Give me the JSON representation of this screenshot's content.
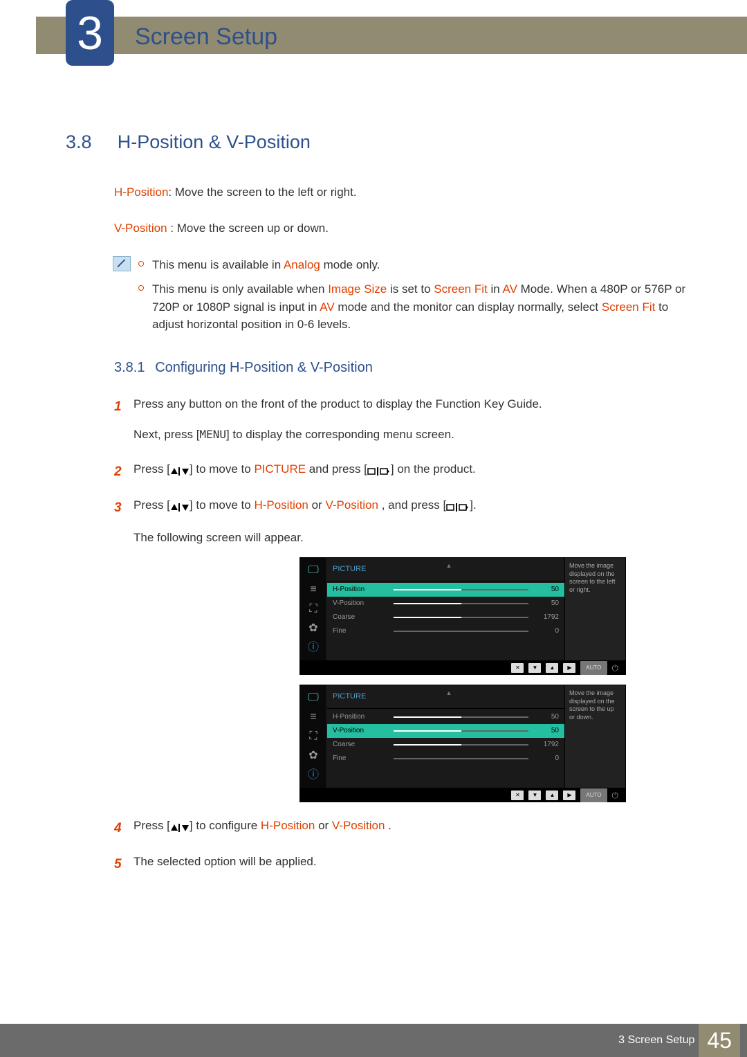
{
  "chapter": {
    "number": "3",
    "title": "Screen Setup"
  },
  "section": {
    "number": "3.8",
    "title": "H-Position & V-Position"
  },
  "intro": {
    "hpos_label": "H-Position",
    "hpos_text": ": Move the screen to the left or right.",
    "vpos_label": "V-Position",
    "vpos_text": " : Move the screen up or down."
  },
  "notes": {
    "item1_pre": "This menu is available in ",
    "item1_mode": "Analog",
    "item1_post": " mode only.",
    "item2_a": "This menu is only available when ",
    "item2_b": "Image Size",
    "item2_c": " is set to ",
    "item2_d": "Screen Fit",
    "item2_e": " in ",
    "item2_f": "AV",
    "item2_g": " Mode. When a 480P or 576P or 720P or 1080P signal is input in ",
    "item2_h": "AV",
    "item2_i": " mode and the monitor can display normally, select ",
    "item2_j": "Screen Fit",
    "item2_k": " to adjust horizontal position in 0-6 levels."
  },
  "subsection": {
    "number": "3.8.1",
    "title": "Configuring H-Position & V-Position"
  },
  "steps": {
    "n1": "1",
    "s1a": "Press any button on the front of the product to display the Function Key Guide.",
    "s1b_pre": "Next, press [",
    "s1b_menu": "MENU",
    "s1b_post": "] to display the corresponding menu screen.",
    "n2": "2",
    "s2_pre": "Press [",
    "s2_mid": "] to move to ",
    "s2_pic": "PICTURE",
    "s2_mid2": " and press [",
    "s2_post": "] on the product.",
    "n3": "3",
    "s3_pre": "Press [",
    "s3_mid": "] to move to ",
    "s3_h": "H-Position",
    "s3_or": " or ",
    "s3_v": " V-Position",
    "s3_mid2": " , and press [",
    "s3_post": "].",
    "s3_follow": "The following screen will appear.",
    "n4": "4",
    "s4_pre": "Press [",
    "s4_mid": "] to configure ",
    "s4_h": "H-Position",
    "s4_or": " or ",
    "s4_v": " V-Position",
    "s4_post": " .",
    "n5": "5",
    "s5": "The selected option will be applied."
  },
  "osd": {
    "picture_label": "PICTURE",
    "hpos": "H-Position",
    "vpos": "V-Position",
    "coarse": "Coarse",
    "fine": "Fine",
    "val_hpos": "50",
    "val_vpos": "50",
    "val_coarse": "1792",
    "val_fine": "0",
    "desc_h": "Move the image displayed on the screen to the left or right.",
    "desc_v": "Move the image displayed on the screen to the up or down.",
    "auto": "AUTO"
  },
  "footer": {
    "text": "3 Screen Setup",
    "page": "45"
  }
}
